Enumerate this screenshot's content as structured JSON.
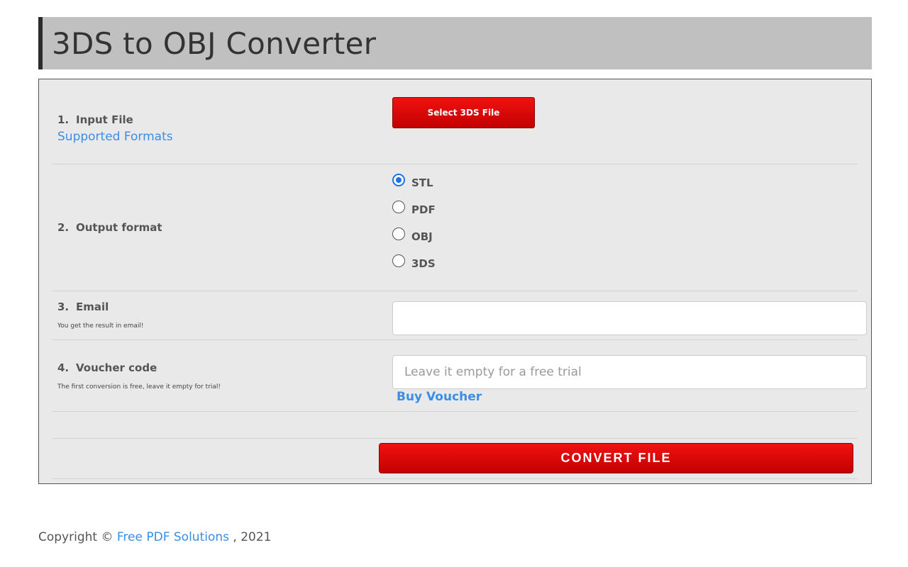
{
  "page_title": "3DS to OBJ Converter",
  "step1": {
    "number": "1.",
    "label": "Input File",
    "supported_formats_link": "Supported Formats",
    "select_button": "Select 3DS File"
  },
  "step2": {
    "number": "2.",
    "label": "Output format",
    "options": [
      {
        "label": "STL",
        "checked": true
      },
      {
        "label": "PDF",
        "checked": false
      },
      {
        "label": "OBJ",
        "checked": false
      },
      {
        "label": "3DS",
        "checked": false
      }
    ]
  },
  "step3": {
    "number": "3.",
    "label": "Email",
    "hint": "You get the result in email!",
    "value": ""
  },
  "step4": {
    "number": "4.",
    "label": "Voucher code",
    "hint": "The first conversion is free, leave it empty for trial!",
    "placeholder": "Leave it empty for a free trial",
    "buy_link": "Buy Voucher"
  },
  "convert_button": "CONVERT FILE",
  "footer": {
    "prefix": "Copyright ©",
    "link": "Free PDF Solutions",
    "suffix": ", 2021"
  },
  "colors": {
    "accent_red": "#d80000",
    "link_blue": "#3a8ee6",
    "radio_blue": "#1a73e8"
  }
}
